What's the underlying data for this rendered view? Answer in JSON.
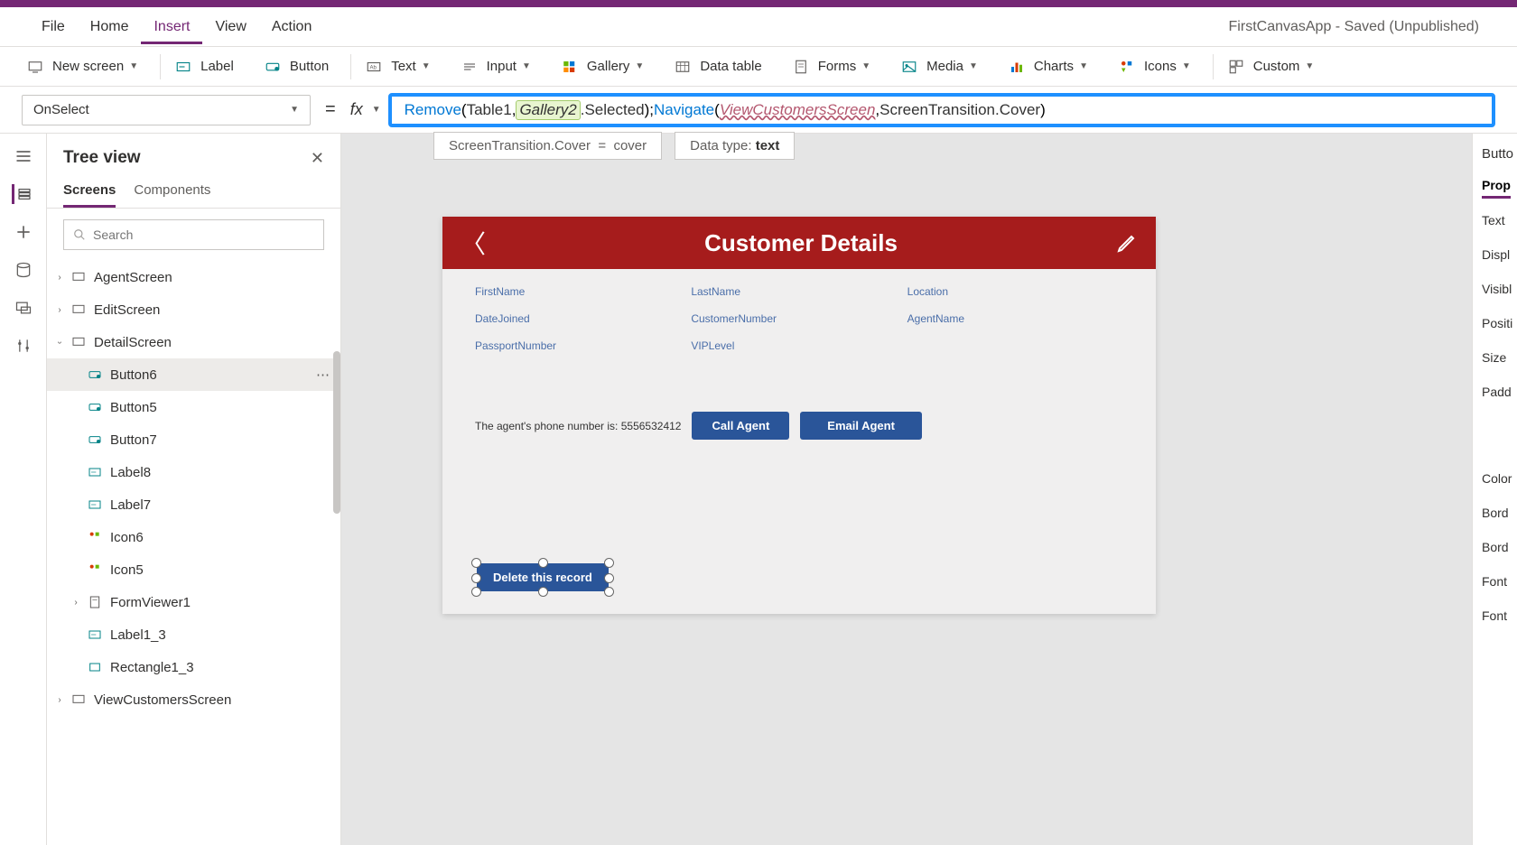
{
  "app_title": "FirstCanvasApp - Saved (Unpublished)",
  "menu": {
    "file": "File",
    "home": "Home",
    "insert": "Insert",
    "view": "View",
    "action": "Action"
  },
  "ribbon": {
    "new_screen": "New screen",
    "label": "Label",
    "button": "Button",
    "text": "Text",
    "input": "Input",
    "gallery": "Gallery",
    "data_table": "Data table",
    "forms": "Forms",
    "media": "Media",
    "charts": "Charts",
    "icons": "Icons",
    "custom": "Custom"
  },
  "property_selector": "OnSelect",
  "formula": {
    "remove": "Remove",
    "table1": "Table1",
    "gallery2": "Gallery2",
    "selected": ".Selected",
    "navigate": "Navigate",
    "screen": "ViewCustomersScreen",
    "transition_obj": "ScreenTransition",
    "cover": ".Cover"
  },
  "intelli": {
    "eval_left": "ScreenTransition.Cover",
    "eval_eq": "=",
    "eval_right": "cover",
    "type_label": "Data type:",
    "type_value": "text"
  },
  "tree": {
    "title": "Tree view",
    "tab_screens": "Screens",
    "tab_components": "Components",
    "search_placeholder": "Search",
    "nodes": {
      "agent": "AgentScreen",
      "edit": "EditScreen",
      "detail": "DetailScreen",
      "btn6": "Button6",
      "btn5": "Button5",
      "btn7": "Button7",
      "lbl8": "Label8",
      "lbl7": "Label7",
      "icon6": "Icon6",
      "icon5": "Icon5",
      "formv": "FormViewer1",
      "lbl13": "Label1_3",
      "rect13": "Rectangle1_3",
      "viewcust": "ViewCustomersScreen"
    }
  },
  "canvas": {
    "header_title": "Customer Details",
    "fields": {
      "firstname": "FirstName",
      "lastname": "LastName",
      "location": "Location",
      "datejoined": "DateJoined",
      "customernumber": "CustomerNumber",
      "agentname": "AgentName",
      "passport": "PassportNumber",
      "vip": "VIPLevel"
    },
    "agent_text": "The agent's phone number is:  5556532412",
    "call_btn": "Call Agent",
    "email_btn": "Email Agent",
    "delete_btn": "Delete this record"
  },
  "props": {
    "header": "Butto",
    "tab": "Prop",
    "rows": [
      "Text",
      "Displ",
      "Visibl",
      "Positi",
      "Size",
      "Padd",
      "Color",
      "Bord",
      "Bord",
      "Font",
      "Font"
    ]
  }
}
